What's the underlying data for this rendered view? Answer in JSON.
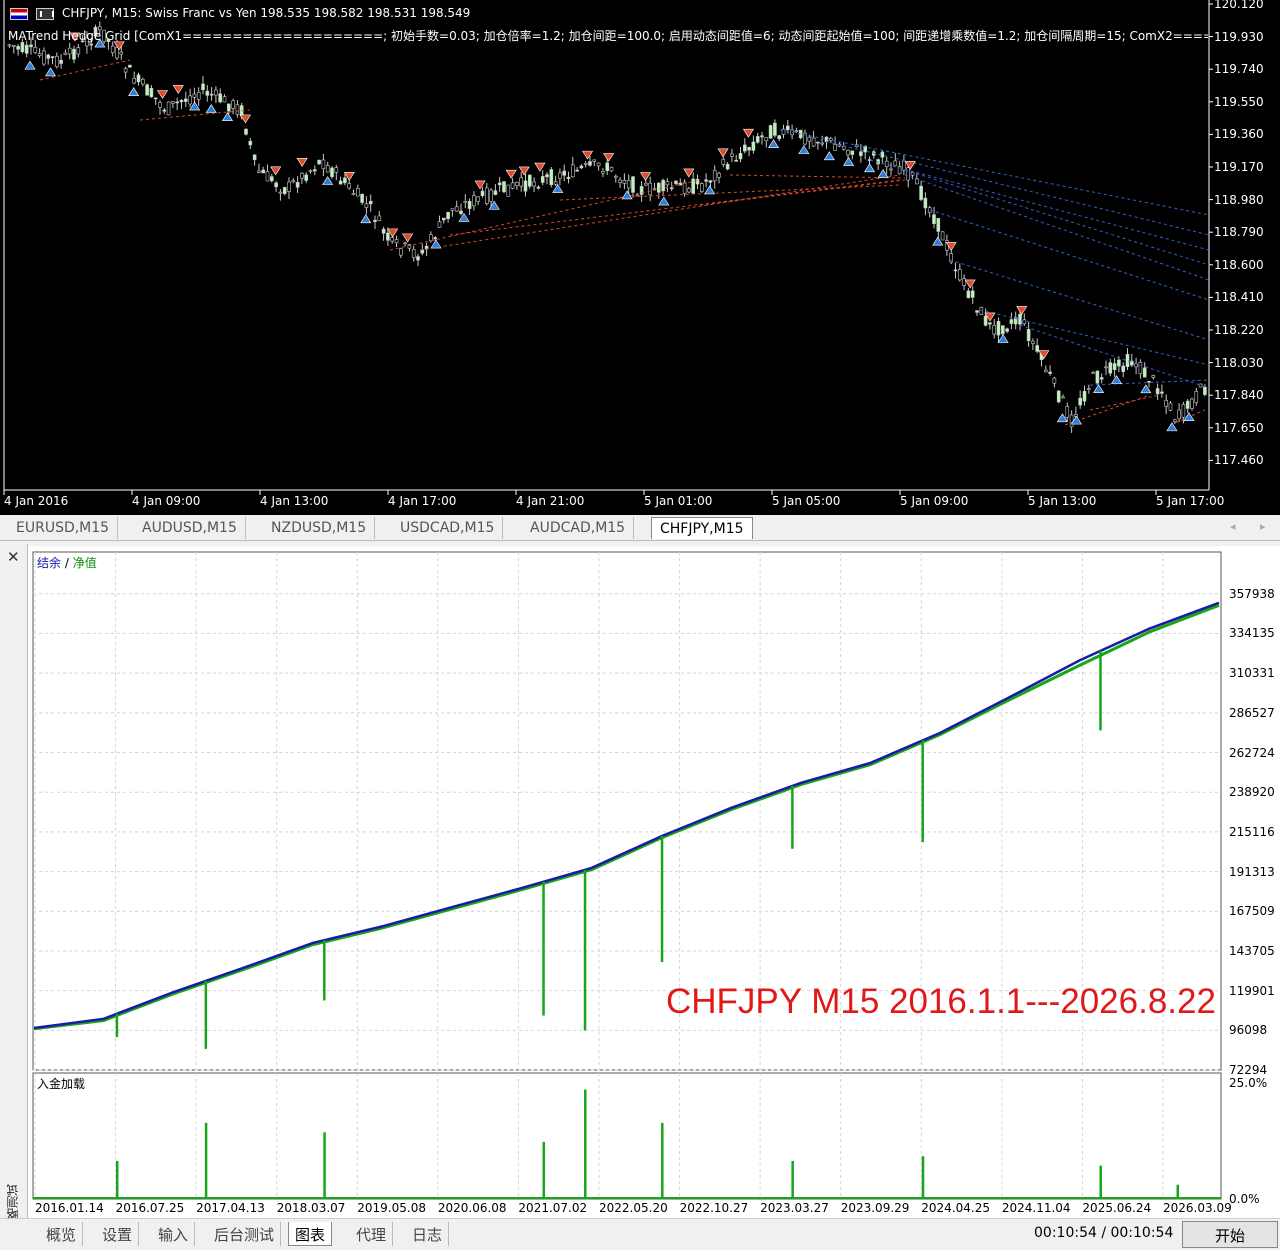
{
  "price_chart": {
    "title": "CHFJPY, M15:  Swiss Franc vs Yen  198.535 198.582 198.531 198.549",
    "ea_label": "MATrend Hedge Grid [ComX1====================; 初始手数=0.03; 加仓倍率=1.2; 加仓间距=100.0; 启用动态间距值=6; 动态间距起始值=100; 间距递增乘数值=1.2; 加仓间隔周期=15; ComX2=========",
    "price_levels": [
      "120.120",
      "119.930",
      "119.740",
      "119.550",
      "119.360",
      "119.170",
      "118.980",
      "118.790",
      "118.600",
      "118.410",
      "118.220",
      "118.030",
      "117.840",
      "117.650",
      "117.460"
    ],
    "time_labels": [
      "4 Jan 2016",
      "4 Jan 09:00",
      "4 Jan 13:00",
      "4 Jan 17:00",
      "4 Jan 21:00",
      "5 Jan 01:00",
      "5 Jan 05:00",
      "5 Jan 09:00",
      "5 Jan 13:00",
      "5 Jan 17:00"
    ],
    "colors": {
      "background": "#000000",
      "bull": "#b9f5b9",
      "buy_arrow": "#2f7fd6",
      "sell_arrow": "#e14a2a"
    }
  },
  "symbol_tabs": [
    "EURUSD,M15",
    "AUDUSD,M15",
    "NZDUSD,M15",
    "USDCAD,M15",
    "AUDCAD,M15",
    "CHFJPY,M15"
  ],
  "active_symbol_tab": "CHFJPY,M15",
  "tester": {
    "side_label": "策略测试",
    "legend_balance": "结余",
    "legend_separator": " / ",
    "legend_equity": "净值",
    "watermark": "CHFJPY M15 2016.1.1---2026.8.22",
    "load_label": "入金加载",
    "load_axis": [
      "25.0%",
      "0.0%"
    ],
    "colors": {
      "balance": "#1a1aa8",
      "equity": "#16a616",
      "load": "#16a616"
    }
  },
  "chart_data": {
    "type": "line",
    "title": "",
    "series": [
      {
        "name": "结余",
        "values": [
          97500,
          103000,
          119000,
          133500,
          148500,
          158500,
          170000,
          181500,
          193500,
          212500,
          229500,
          244500,
          256500,
          274500,
          296000,
          318000,
          337000,
          352500
        ]
      },
      {
        "name": "净值",
        "values": [
          97000,
          102000,
          118000,
          132500,
          147500,
          157500,
          169000,
          180500,
          192500,
          211500,
          228500,
          243500,
          255500,
          273500,
          294500,
          315000,
          335000,
          351000
        ]
      }
    ],
    "x_ticks": [
      "2016.01.14",
      "2016.07.25",
      "2017.04.13",
      "2018.03.07",
      "2019.05.08",
      "2020.06.08",
      "2021.07.02",
      "2022.05.20",
      "2022.10.27",
      "2023.03.27",
      "2023.09.29",
      "2024.04.25",
      "2024.11.04",
      "2025.06.24",
      "2026.03.09"
    ],
    "y_ticks": [
      "357938",
      "334135",
      "310331",
      "286527",
      "262724",
      "238920",
      "215116",
      "191313",
      "167509",
      "143705",
      "119901",
      "96098",
      "72294"
    ],
    "ylim": [
      72294,
      365000
    ],
    "drawdowns": [
      {
        "pos": 0.07,
        "value": 92000
      },
      {
        "pos": 0.145,
        "value": 85000
      },
      {
        "pos": 0.245,
        "value": 114000
      },
      {
        "pos": 0.43,
        "value": 105000
      },
      {
        "pos": 0.465,
        "value": 96000
      },
      {
        "pos": 0.53,
        "value": 137000
      },
      {
        "pos": 0.64,
        "value": 205000
      },
      {
        "pos": 0.75,
        "value": 209000
      },
      {
        "pos": 0.9,
        "value": 276000
      }
    ],
    "load_series": [
      {
        "pos": 0.07,
        "value": 8
      },
      {
        "pos": 0.145,
        "value": 16
      },
      {
        "pos": 0.245,
        "value": 14
      },
      {
        "pos": 0.43,
        "value": 12
      },
      {
        "pos": 0.465,
        "value": 23
      },
      {
        "pos": 0.53,
        "value": 16
      },
      {
        "pos": 0.64,
        "value": 8
      },
      {
        "pos": 0.75,
        "value": 9
      },
      {
        "pos": 0.9,
        "value": 7
      },
      {
        "pos": 0.965,
        "value": 3
      }
    ],
    "grid": true
  },
  "bottom_tabs": [
    "概览",
    "设置",
    "输入",
    "后台测试",
    "图表",
    "代理",
    "日志"
  ],
  "active_bottom_tab": "图表",
  "timer": "00:10:54 / 00:10:54",
  "start_button": "开始"
}
